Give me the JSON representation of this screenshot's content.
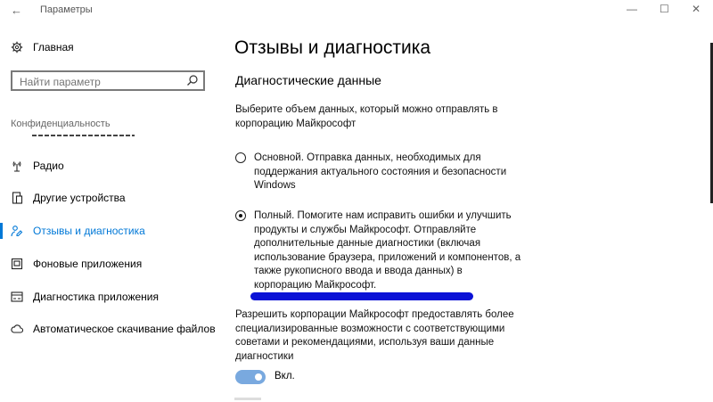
{
  "window": {
    "title": "Параметры",
    "back_glyph": "←",
    "min_glyph": "—",
    "max_glyph": "☐",
    "close_glyph": "✕"
  },
  "sidebar": {
    "home_label": "Главная",
    "search_placeholder": "Найти параметр",
    "section_label": "Конфиденциальность",
    "items": [
      {
        "label": "Радио",
        "icon": "radio-icon",
        "active": false
      },
      {
        "label": "Другие устройства",
        "icon": "devices-icon",
        "active": false
      },
      {
        "label": "Отзывы и диагностика",
        "icon": "feedback-icon",
        "active": true
      },
      {
        "label": "Фоновые приложения",
        "icon": "background-apps-icon",
        "active": false
      },
      {
        "label": "Диагностика приложения",
        "icon": "app-diagnostics-icon",
        "active": false
      },
      {
        "label": "Автоматическое скачивание файлов",
        "icon": "cloud-download-icon",
        "active": false
      }
    ]
  },
  "main": {
    "title": "Отзывы и диагностика",
    "section_title": "Диагностические данные",
    "description": "Выберите объем данных, который можно отправлять в корпорацию Майкрософт",
    "options": [
      {
        "label": "Основной. Отправка данных, необходимых для поддержания актуального состояния и безопасности Windows",
        "selected": false
      },
      {
        "label": "Полный. Помогите нам исправить ошибки и улучшить продукты и службы Майкрософт. Отправляйте дополнительные данные диагностики (включая использование браузера, приложений и компонентов, а также рукописного ввода и ввода данных) в корпорацию Майкрософт.",
        "selected": true
      }
    ],
    "allow_text": "Разрешить корпорации Майкрософт предоставлять более специализированные возможности с соответствующими советами и рекомендациями, используя ваши данные диагностики",
    "toggle_label": "Вкл.",
    "toggle_on": true
  },
  "colors": {
    "accent": "#0078d7",
    "toggle_on": "#79a9df",
    "redaction": "#0b12d6"
  }
}
